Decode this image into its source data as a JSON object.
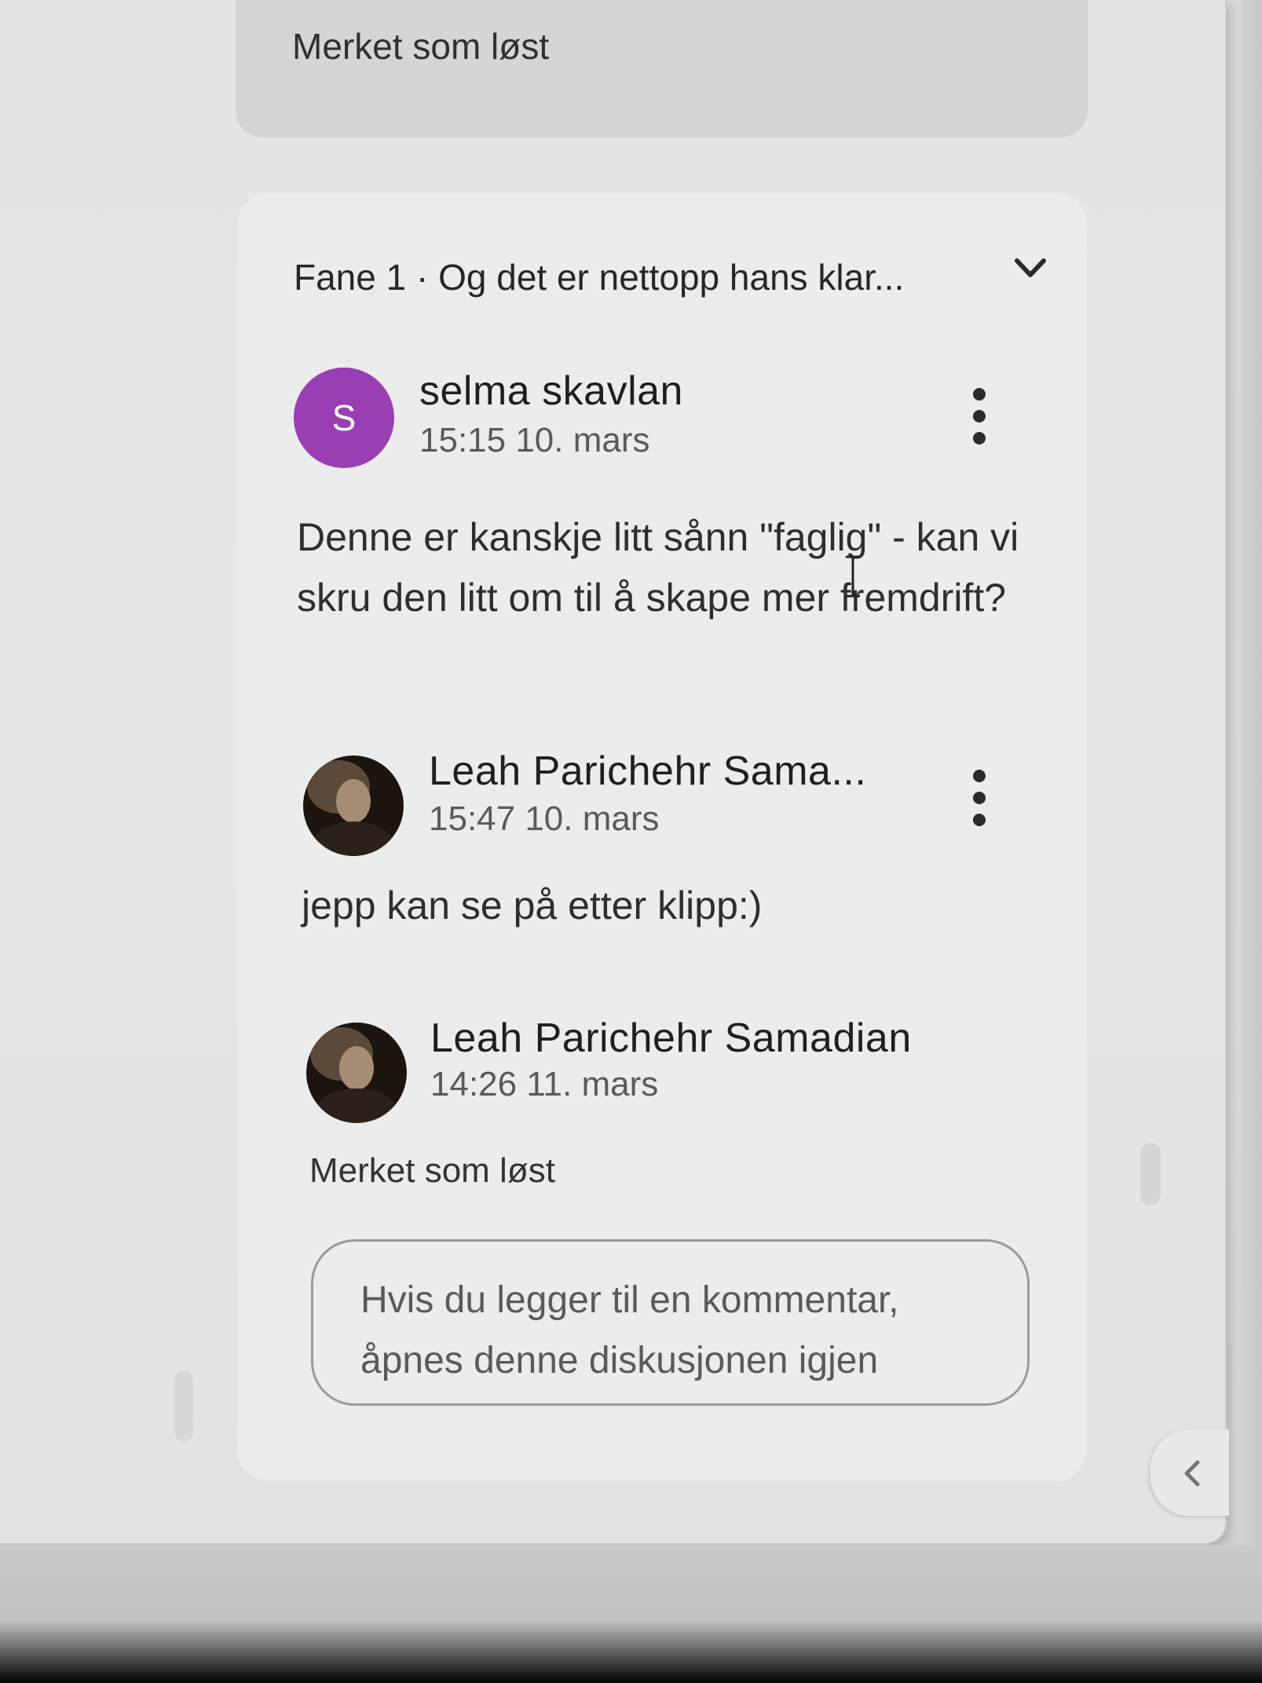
{
  "previous_thread": {
    "status": "Merket som løst"
  },
  "thread": {
    "header": "Fane 1 · Og det er nettopp hans klar...",
    "comments": [
      {
        "avatar_initial": "S",
        "author": "selma skavlan",
        "timestamp": "15:15 10. mars",
        "text": "Denne er kanskje litt sånn \"faglig\" - kan vi skru den litt om til å skape mer fremdrift?"
      },
      {
        "author": "Leah Parichehr Sama...",
        "timestamp": "15:47 10. mars",
        "text": "jepp kan se på etter klipp:)"
      },
      {
        "author": "Leah Parichehr Samadian",
        "timestamp": "14:26 11. mars",
        "status": "Merket som løst"
      }
    ],
    "reply_placeholder": "Hvis du legger til en kommentar, åpnes denne diskusjonen igjen"
  },
  "colors": {
    "avatar_purple": "#9a3fb3",
    "card_background": "#ebedec"
  },
  "icons": [
    "chevron-down-icon",
    "more-vert-icon",
    "chevron-left-icon",
    "text-cursor-icon"
  ]
}
